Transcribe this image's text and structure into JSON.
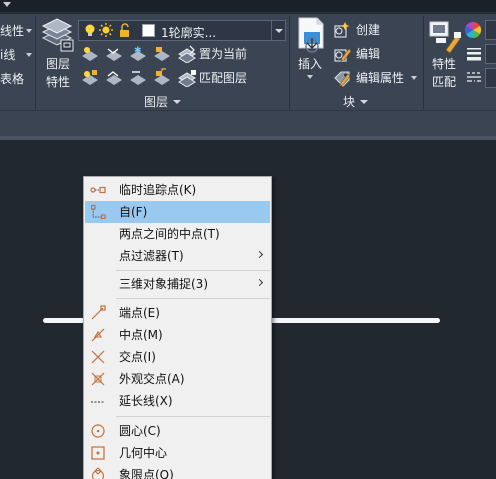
{
  "ribbon": {
    "left_panel": {
      "labels": [
        "线性",
        "i线",
        "表格"
      ]
    },
    "layer_properties_button": {
      "label_line1": "图层",
      "label_line2": "特性"
    },
    "layer_combo": {
      "current_layer": "1轮廓实...",
      "swatch_color": "#ffffff"
    },
    "layer_tools": {
      "make_current": "置为当前",
      "match_layer": "匹配图层"
    },
    "layers_panel_title": "图层",
    "insert_button": {
      "label": "插入"
    },
    "block_tools": {
      "create": "创建",
      "edit": "编辑",
      "edit_attributes": "编辑属性"
    },
    "block_panel_title": "块",
    "match_properties_button": {
      "label_line1": "特性",
      "label_line2": "匹配"
    }
  },
  "context_menu": {
    "items": [
      {
        "label": "临时追踪点(K)",
        "icon": "temporary-track-point-icon"
      },
      {
        "label": "自(F)",
        "icon": "from-icon",
        "highlighted": true
      },
      {
        "label": "两点之间的中点(T)"
      },
      {
        "label": "点过滤器(T)",
        "has_submenu": true
      },
      {
        "label": "三维对象捕捉(3)",
        "has_submenu": true
      },
      {
        "label": "端点(E)",
        "icon": "endpoint-icon"
      },
      {
        "label": "中点(M)",
        "icon": "midpoint-icon"
      },
      {
        "label": "交点(I)",
        "icon": "intersection-icon"
      },
      {
        "label": "外观交点(A)",
        "icon": "apparent-intersection-icon"
      },
      {
        "label": "延长线(X)",
        "icon": "extension-icon"
      },
      {
        "label": "圆心(C)",
        "icon": "center-icon"
      },
      {
        "label": "几何中心",
        "icon": "geometric-center-icon"
      },
      {
        "label": "象限点(Q)",
        "icon": "quadrant-icon"
      }
    ]
  },
  "colors": {
    "ribbon_bg": "#3a4452",
    "canvas_bg": "#212830",
    "menu_bg": "#f0f0f0",
    "menu_highlight": "#99c9ef",
    "snap_icon": "#c0703a"
  }
}
